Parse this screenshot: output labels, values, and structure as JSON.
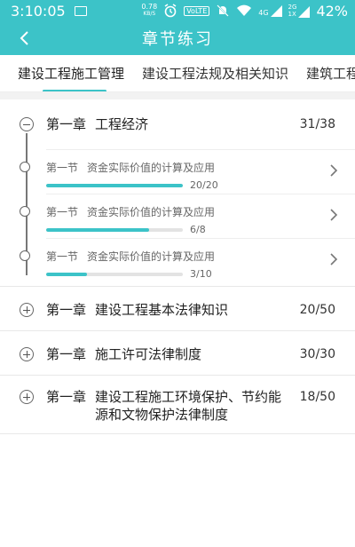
{
  "status_bar": {
    "time": "3:10:05",
    "net_speed_value": "0.78",
    "net_speed_unit": "KB/S",
    "volte": "VoLTE",
    "signal_4g": "4G",
    "signal_2g": "2G",
    "signal_1x": "1X",
    "battery": "42%"
  },
  "app_bar": {
    "title": "章节练习"
  },
  "tabs": [
    {
      "label": "建设工程施工管理"
    },
    {
      "label": "建设工程法规及相关知识"
    },
    {
      "label": "建筑工程管"
    }
  ],
  "chapters": [
    {
      "num": "第一章",
      "name": "工程经济",
      "count": "31/38",
      "expanded": true,
      "sections": [
        {
          "num": "第一节",
          "name": "资金实际价值的计算及应用",
          "count": "20/20",
          "progress": 1.0
        },
        {
          "num": "第一节",
          "name": "资金实际价值的计算及应用",
          "count": "6/8",
          "progress": 0.75
        },
        {
          "num": "第一节",
          "name": "资金实际价值的计算及应用",
          "count": "3/10",
          "progress": 0.3
        }
      ]
    },
    {
      "num": "第一章",
      "name": "建设工程基本法律知识",
      "count": "20/50",
      "expanded": false
    },
    {
      "num": "第一章",
      "name": "施工许可法律制度",
      "count": "30/30",
      "expanded": false
    },
    {
      "num": "第一章",
      "name": "建设工程施工环境保护、节约能源和文物保护法律制度",
      "count": "18/50",
      "expanded": false
    }
  ],
  "colors": {
    "accent": "#3cc3c8"
  },
  "icons": {
    "back": "chevron-left-icon",
    "section_arrow": "chevron-right-icon",
    "collapse": "minus-circle-icon",
    "expand": "plus-circle-icon"
  }
}
